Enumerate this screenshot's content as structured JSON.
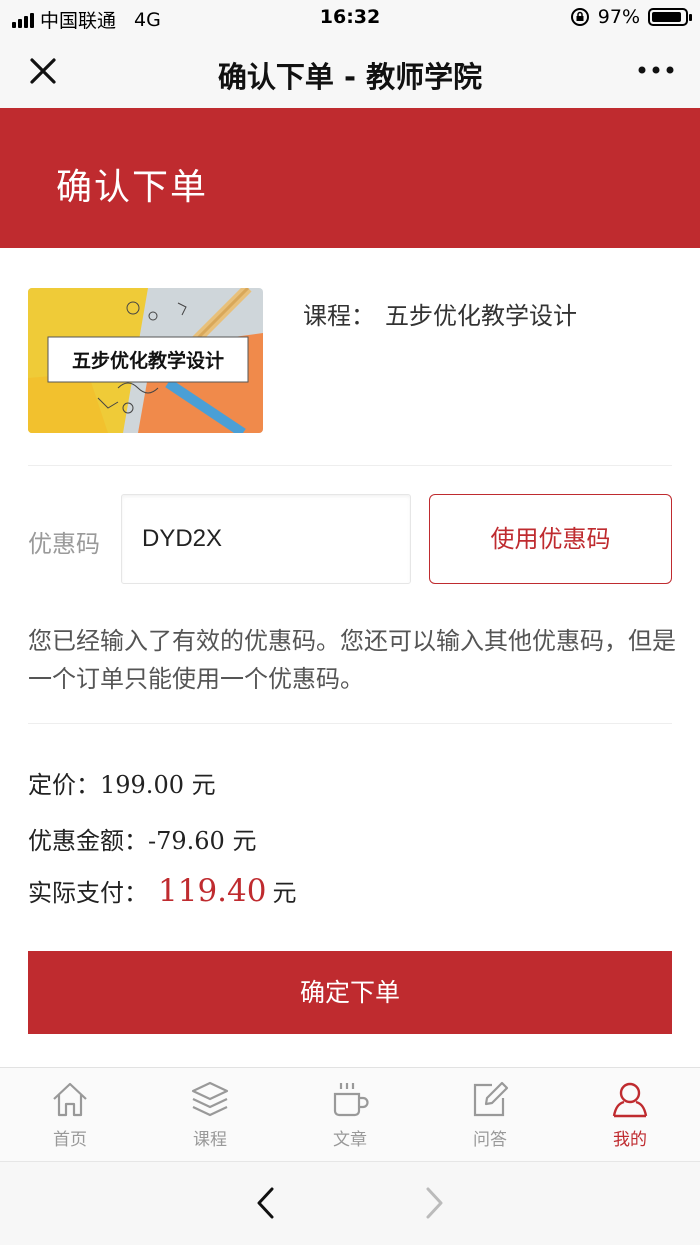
{
  "status_bar": {
    "carrier": "中国联通",
    "network": "4G",
    "time": "16:32",
    "battery": "97%",
    "battery_level": 0.97
  },
  "nav": {
    "title": "确认下单 - 教师学院",
    "close_icon": "close-icon",
    "more_icon": "more-icon"
  },
  "header": {
    "title": "确认下单",
    "color": "#bf2b2f"
  },
  "course": {
    "label": "课程：",
    "name": "五步优化教学设计",
    "thumbnail_text": "五步优化教学设计"
  },
  "coupon": {
    "label": "优惠码",
    "value": "DYD2X",
    "button": "使用优惠码",
    "notice": "您已经输入了有效的优惠码。您还可以输入其他优惠码，但是一个订单只能使用一个优惠码。"
  },
  "pricing": {
    "list_label": "定价：",
    "list_price": "199.00",
    "discount_label": "优惠金额：",
    "discount": "-79.60",
    "pay_label": "实际支付：",
    "pay": "119.40",
    "unit": "元"
  },
  "submit_button": "确定下单",
  "tabs": [
    {
      "label": "首页",
      "icon": "home-icon",
      "active": false
    },
    {
      "label": "课程",
      "icon": "layers-icon",
      "active": false
    },
    {
      "label": "文章",
      "icon": "coffee-icon",
      "active": false
    },
    {
      "label": "问答",
      "icon": "edit-icon",
      "active": false
    },
    {
      "label": "我的",
      "icon": "user-icon",
      "active": true
    }
  ],
  "browser": {
    "back_icon": "chevron-left-icon",
    "forward_icon": "chevron-right-icon"
  }
}
